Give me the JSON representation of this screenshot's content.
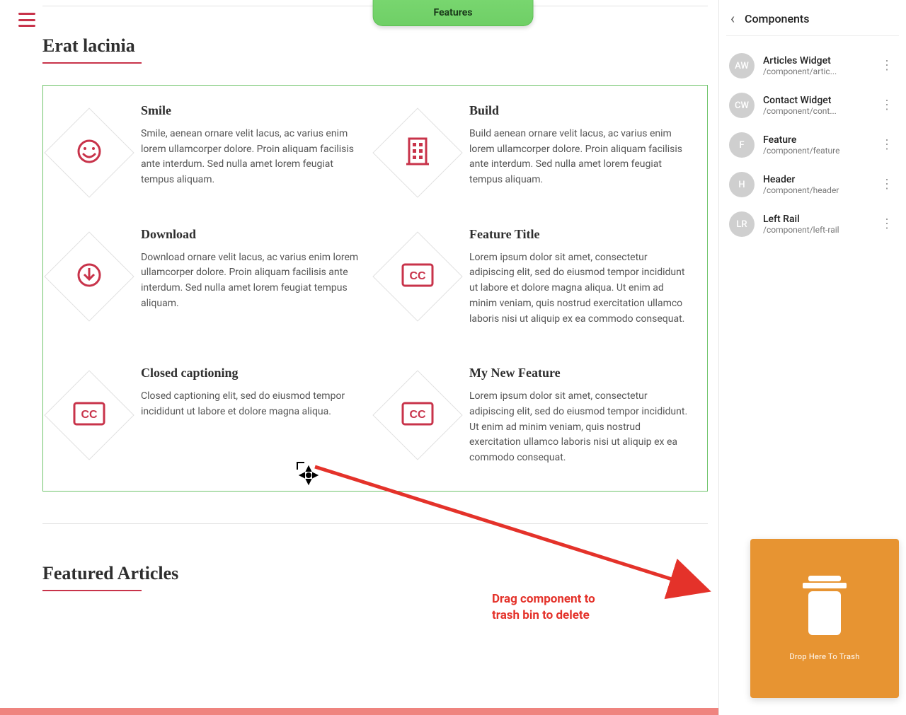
{
  "topbar": {
    "pill_label": "Features"
  },
  "main": {
    "section_title": "Erat lacinia",
    "featured_title": "Featured Articles"
  },
  "features": [
    {
      "title": "Smile",
      "icon": "smile-icon",
      "body": "Smile, aenean ornare velit lacus, ac varius enim lorem ullamcorper dolore. Proin aliquam facilisis ante interdum. Sed nulla amet lorem feugiat tempus aliquam."
    },
    {
      "title": "Build",
      "icon": "building-icon",
      "body": "Build aenean ornare velit lacus, ac varius enim lorem ullamcorper dolore. Proin aliquam facilisis ante interdum. Sed nulla amet lorem feugiat tempus aliquam."
    },
    {
      "title": "Download",
      "icon": "download-icon",
      "body": "Download ornare velit lacus, ac varius enim lorem ullamcorper dolore. Proin aliquam facilisis ante interdum. Sed nulla amet lorem feugiat tempus aliquam."
    },
    {
      "title": "Feature Title",
      "icon": "cc-icon",
      "body": "Lorem ipsum dolor sit amet, consectetur adipiscing elit, sed do eiusmod tempor incididunt ut labore et dolore magna aliqua. Ut enim ad minim veniam, quis nostrud exercitation ullamco laboris nisi ut aliquip ex ea commodo consequat."
    },
    {
      "title": "Closed captioning",
      "icon": "cc-icon",
      "body": "Closed captioning elit, sed do eiusmod tempor incididunt ut labore et dolore magna aliqua."
    },
    {
      "title": "My New Feature",
      "icon": "cc-icon",
      "body": "Lorem ipsum dolor sit amet, consectetur adipiscing elit, sed do eiusmod tempor incididunt. Ut enim ad minim veniam, quis nostrud exercitation ullamco laboris nisi ut aliquip ex ea commodo consequat."
    }
  ],
  "sidebar": {
    "title": "Components",
    "items": [
      {
        "abbr": "AW",
        "name": "Articles Widget",
        "path": "/component/artic..."
      },
      {
        "abbr": "CW",
        "name": "Contact Widget",
        "path": "/component/cont..."
      },
      {
        "abbr": "F",
        "name": "Feature",
        "path": "/component/feature"
      },
      {
        "abbr": "H",
        "name": "Header",
        "path": "/component/header"
      },
      {
        "abbr": "LR",
        "name": "Left Rail",
        "path": "/component/left-rail"
      }
    ]
  },
  "trash": {
    "label": "Drop Here To Trash"
  },
  "annotation": {
    "text": "Drag component to\ntrash bin to delete"
  }
}
